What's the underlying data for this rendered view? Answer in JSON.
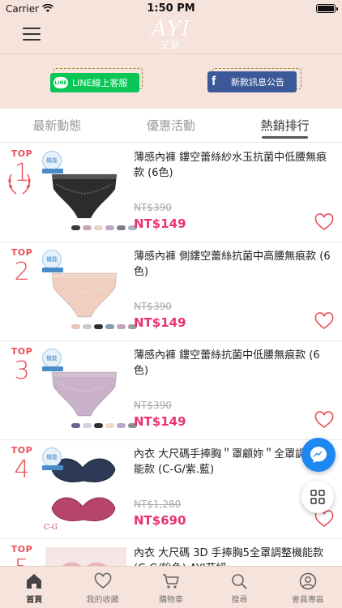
{
  "status_bar": {
    "carrier": "Carrier",
    "time": "1:50 PM"
  },
  "header": {
    "logo_main": "AYI",
    "logo_sub": "艾妍"
  },
  "banners": {
    "line_label": "LINE線上客服",
    "line_logo": "LINE",
    "fb_label": "新款訊息公告",
    "fb_logo": "f"
  },
  "tabs": [
    {
      "label": "最新動態",
      "active": false
    },
    {
      "label": "優惠活動",
      "active": false
    },
    {
      "label": "熱銷排行",
      "active": true
    }
  ],
  "products": [
    {
      "rank_prefix": "TOP",
      "rank": "1",
      "title": "薄感內褲 鏤空蕾絲紗水玉抗菌中低腰無痕款 (6色)",
      "old_price": "NT$390",
      "price": "NT$149",
      "badge": "機能",
      "color": "#2c2c2c",
      "swatches": [
        "#3a3a3a",
        "#c9a7b0",
        "#e6d3c6",
        "#bfa6c4",
        "#7b7e86",
        "#adb6c2"
      ]
    },
    {
      "rank_prefix": "TOP",
      "rank": "2",
      "title": "薄感內褲 側鏤空蕾絲抗菌中高腰無痕款 (6色)",
      "old_price": "NT$390",
      "price": "NT$149",
      "badge": "機能",
      "color": "#f0cfc0",
      "swatches": [
        "#e9c5b4",
        "#c9c9c9",
        "#2f2f2f",
        "#8a9ab0",
        "#c6a1c0",
        "#9b9ea6"
      ]
    },
    {
      "rank_prefix": "TOP",
      "rank": "3",
      "title": "薄感內褲 鏤空蕾絲抗菌中低腰無痕款 (6色)",
      "old_price": "NT$390",
      "price": "NT$149",
      "badge": "機能",
      "color": "#c9b2c9",
      "swatches": [
        "#6a5f8f",
        "#d7cfe0",
        "#2e2e2e",
        "#f1dbd0",
        "#b7a7c8",
        "#8c8f98"
      ]
    },
    {
      "rank_prefix": "TOP",
      "rank": "4",
      "title": "內衣 大尺碼手捧胸＂罩顧妳＂全罩調整機能款 (C-G/紫.藍)",
      "old_price": "NT$1,280",
      "price": "NT$690",
      "badge": "機能",
      "color": "#2d3a55",
      "swatches": []
    },
    {
      "rank_prefix": "TOP",
      "rank": "5",
      "title": "內衣 大尺碼 3D 手捧胸5全罩調整機能款 (C-G/粉色) AYI艾妍",
      "old_price": "",
      "price": "",
      "badge": "",
      "color": "#f3d8d8",
      "swatches": []
    }
  ],
  "bottom_nav": [
    {
      "label": "首頁",
      "icon": "home-icon",
      "active": true
    },
    {
      "label": "我的收藏",
      "icon": "heart-icon",
      "active": false
    },
    {
      "label": "購物車",
      "icon": "cart-icon",
      "active": false
    },
    {
      "label": "搜尋",
      "icon": "search-icon",
      "active": false
    },
    {
      "label": "會員專區",
      "icon": "user-icon",
      "active": false
    }
  ],
  "colors": {
    "header_bg": "#f6e3dc",
    "accent_red": "#e94f57",
    "price_pink": "#e8336d",
    "line_green": "#06c755",
    "fb_blue": "#3b5998",
    "messenger_blue": "#1e88f2"
  }
}
